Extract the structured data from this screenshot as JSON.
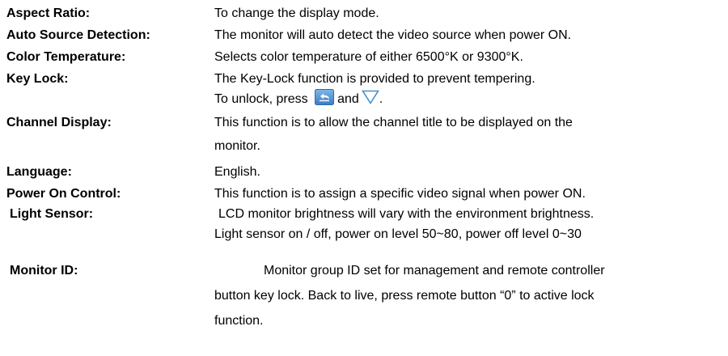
{
  "entries": [
    {
      "term": "Aspect Ratio:",
      "lines": [
        "To change the display mode."
      ]
    },
    {
      "term": "Auto Source Detection:",
      "lines": [
        "The monitor will auto detect the video source when power ON."
      ]
    },
    {
      "term": "Color Temperature:",
      "lines": [
        "Selects color temperature of either 6500°K or 9300°K."
      ]
    },
    {
      "term": "Key Lock:",
      "lines": [
        "The Key-Lock function is provided to prevent tempering."
      ],
      "unlock_prefix": "To unlock, press",
      "unlock_and": "and",
      "unlock_suffix": ".",
      "icons": [
        "back-arrow-icon",
        "down-triangle-icon"
      ],
      "icon_color": "#4a8fd0"
    },
    {
      "term": "Channel Display:",
      "lines": [
        "This function is to allow the channel title to be displayed on the",
        "monitor."
      ]
    },
    {
      "term": "Language:",
      "lines": [
        "English."
      ]
    },
    {
      "term": "Power On Control:",
      "lines": [
        "This function is to assign a specific video signal when power ON."
      ]
    },
    {
      "term": "Light Sensor:",
      "lines": [
        "LCD monitor brightness will vary with the environment brightness.",
        "Light sensor on / off, power on level 50~80, power off level 0~30"
      ]
    },
    {
      "term": "Monitor ID:",
      "lines": [
        "Monitor group ID set for management and remote controller",
        "button key lock. Back to live, press remote button “0” to active lock",
        "function."
      ]
    }
  ]
}
